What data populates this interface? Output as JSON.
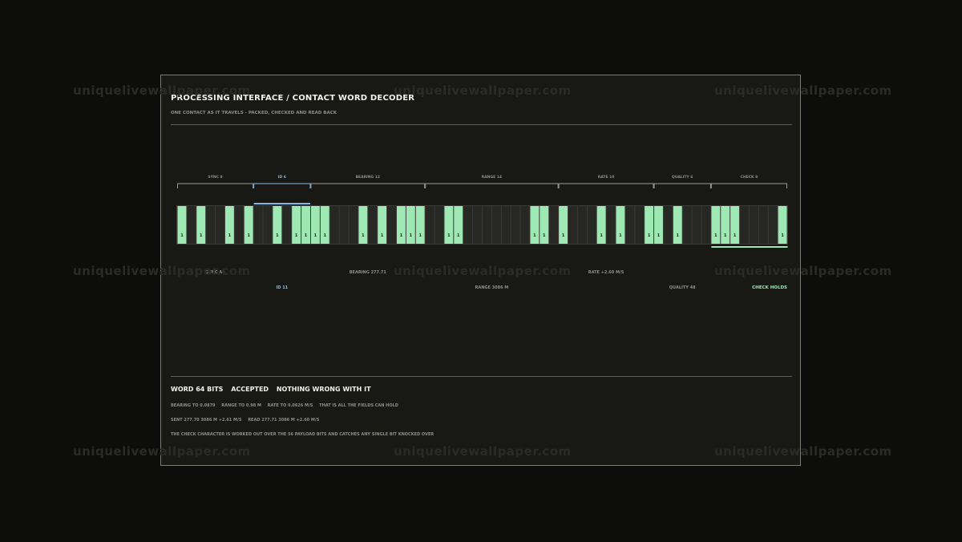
{
  "header": {
    "title": "PROCESSING INTERFACE / CONTACT WORD DECODER",
    "subtitle": "ONE CONTACT AS IT TRAVELS - PACKED, CHECKED AND READ BACK"
  },
  "fields": [
    {
      "label": "SYNC 8",
      "start": 0,
      "length": 8,
      "highlight": "none",
      "readout": "SYNC A5",
      "readout_row": 1
    },
    {
      "label": "ID 6",
      "start": 8,
      "length": 6,
      "highlight": "blue",
      "readout": "ID 11",
      "readout_row": 2
    },
    {
      "label": "BEARING 12",
      "start": 14,
      "length": 12,
      "highlight": "none",
      "readout": "BEARING 277.71",
      "readout_row": 1
    },
    {
      "label": "RANGE 14",
      "start": 26,
      "length": 14,
      "highlight": "none",
      "readout": "RANGE  3086 M",
      "readout_row": 2
    },
    {
      "label": "RATE 10",
      "start": 40,
      "length": 10,
      "highlight": "none",
      "readout": "RATE +2.60 M/S",
      "readout_row": 1
    },
    {
      "label": "QUALITY 6",
      "start": 50,
      "length": 6,
      "highlight": "none",
      "readout": "QUALITY 48",
      "readout_row": 2
    },
    {
      "label": "CHECK 8",
      "start": 56,
      "length": 8,
      "highlight": "green",
      "readout": "CHECK HOLDS",
      "readout_row": 2
    }
  ],
  "bits": [
    1,
    0,
    1,
    0,
    0,
    1,
    0,
    1,
    0,
    0,
    1,
    0,
    1,
    1,
    1,
    1,
    0,
    0,
    0,
    1,
    0,
    1,
    0,
    1,
    1,
    1,
    0,
    0,
    1,
    1,
    0,
    0,
    0,
    0,
    0,
    0,
    0,
    1,
    1,
    0,
    1,
    0,
    0,
    0,
    1,
    0,
    1,
    0,
    0,
    1,
    1,
    0,
    1,
    0,
    0,
    0,
    1,
    1,
    1,
    0,
    0,
    0,
    0,
    1
  ],
  "bit_one_label": "1",
  "status": {
    "word": "WORD 64 BITS",
    "verdict": "ACCEPTED",
    "note": "NOTHING WRONG WITH IT"
  },
  "resolution": {
    "bearing": "BEARING TO 0.0879",
    "range": "RANGE TO 0.98 M",
    "rate": "RATE TO 0.0626 M/S",
    "note": "THAT IS ALL THE FIELDS CAN HOLD"
  },
  "comparison": {
    "sent": "SENT 277.70  3086 M +2.61 M/S",
    "read": "READ 277.71  3086 M +2.60 M/S"
  },
  "footnote": "THE CHECK CHARACTER IS WORKED OUT OVER THE 56 PAYLOAD BITS AND CATCHES ANY SINGLE BIT KNOCKED OVER",
  "watermark": "uniquelivewallpaper.com",
  "colors": {
    "page_bg": "#0d0d0b",
    "panel_bg": "#181815",
    "bit_one": "#9ee8b4",
    "bit_zero": "#272724",
    "id_highlight": "#7fb7e6",
    "check_highlight": "#9ee8b4"
  }
}
